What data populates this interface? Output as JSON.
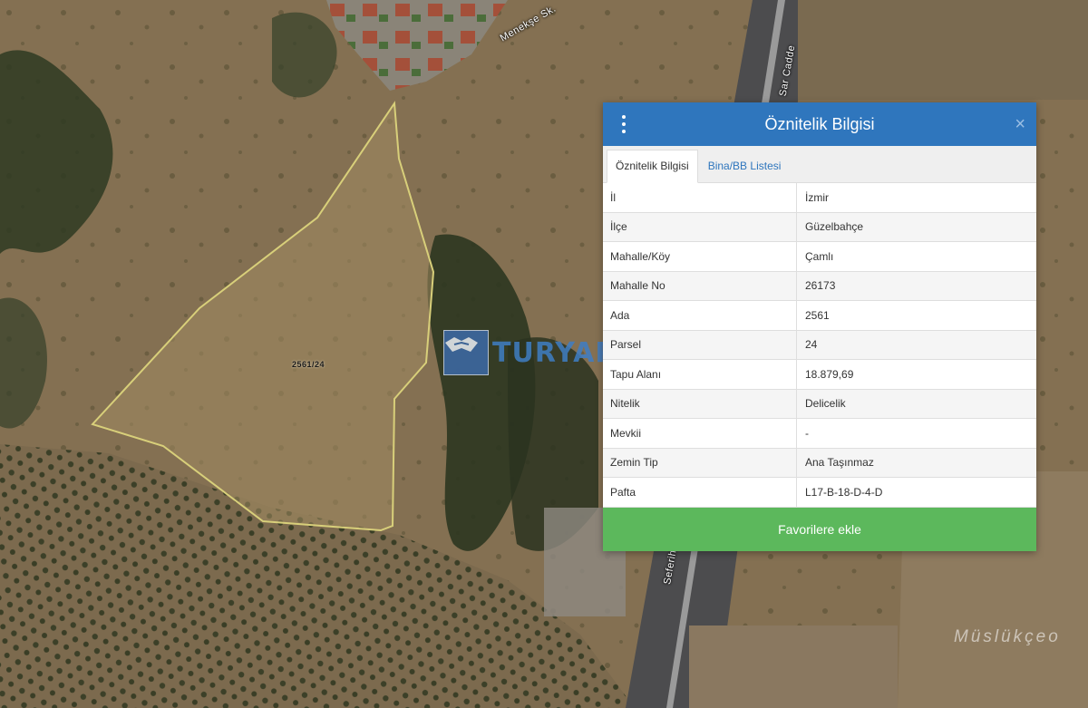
{
  "map": {
    "street_labels": {
      "top": "Menekşe Sk.",
      "road_north": "Sar Cadde",
      "road_south": "Seferihisar"
    },
    "place_label": "Müslükçeo",
    "parcel_label": "2561/24",
    "parcel_outline_color": "#d8cf7a"
  },
  "watermark": {
    "text": "TURYAP",
    "icon": "handshake-icon"
  },
  "panel": {
    "title": "Öznitelik Bilgisi",
    "menu_icon": "kebab-menu-icon",
    "close_icon": "×",
    "tabs": [
      {
        "label": "Öznitelik Bilgisi",
        "active": true
      },
      {
        "label": "Bina/BB Listesi",
        "active": false
      }
    ],
    "rows": [
      {
        "key": "İl",
        "value": "İzmir"
      },
      {
        "key": "İlçe",
        "value": "Güzelbahçe"
      },
      {
        "key": "Mahalle/Köy",
        "value": "Çamlı"
      },
      {
        "key": "Mahalle No",
        "value": "26173"
      },
      {
        "key": "Ada",
        "value": "2561"
      },
      {
        "key": "Parsel",
        "value": "24"
      },
      {
        "key": "Tapu Alanı",
        "value": "18.879,69"
      },
      {
        "key": "Nitelik",
        "value": "Delicelik"
      },
      {
        "key": "Mevkii",
        "value": "-"
      },
      {
        "key": "Zemin Tip",
        "value": "Ana Taşınmaz"
      },
      {
        "key": "Pafta",
        "value": "L17-B-18-D-4-D"
      }
    ],
    "favorite_button": "Favorilere ekle",
    "colors": {
      "header": "#2f76bd",
      "button": "#5cb85c",
      "tab_link": "#2f76bd"
    }
  }
}
